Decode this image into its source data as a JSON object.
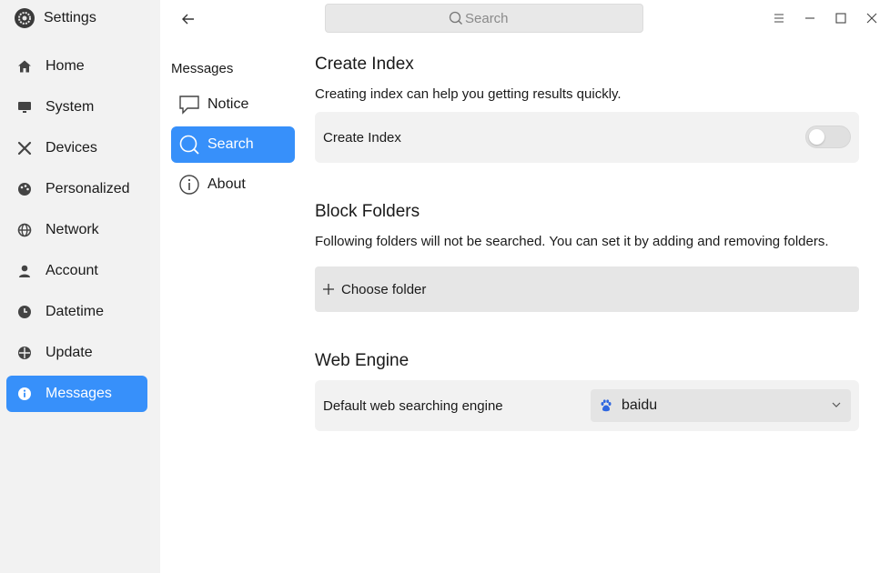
{
  "app": {
    "title": "Settings",
    "icon": "settings-gear-icon"
  },
  "sidebar": {
    "items": [
      {
        "label": "Home",
        "icon": "home-icon"
      },
      {
        "label": "System",
        "icon": "monitor-icon"
      },
      {
        "label": "Devices",
        "icon": "devices-tools-icon"
      },
      {
        "label": "Personalized",
        "icon": "palette-icon"
      },
      {
        "label": "Network",
        "icon": "globe-icon"
      },
      {
        "label": "Account",
        "icon": "person-icon"
      },
      {
        "label": "Datetime",
        "icon": "clock-icon"
      },
      {
        "label": "Update",
        "icon": "update-icon"
      },
      {
        "label": "Messages",
        "icon": "info-icon",
        "active": true
      }
    ]
  },
  "middle": {
    "heading": "Messages",
    "items": [
      {
        "label": "Notice",
        "icon": "chat-bubble-icon"
      },
      {
        "label": "Search",
        "icon": "search-icon",
        "active": true
      },
      {
        "label": "About",
        "icon": "info-circle-icon"
      }
    ]
  },
  "search": {
    "placeholder": "Search"
  },
  "content": {
    "create_index": {
      "title": "Create Index",
      "description": "Creating index can help you getting results quickly.",
      "toggle_label": "Create Index",
      "toggle_on": false
    },
    "block_folders": {
      "title": "Block Folders",
      "description": "Following folders will not be searched. You can set it by adding and removing folders.",
      "choose_label": "Choose folder"
    },
    "web_engine": {
      "title": "Web Engine",
      "row_label": "Default web searching engine",
      "selected": "baidu",
      "selected_icon": "baidu-paw-icon"
    }
  },
  "colors": {
    "accent": "#3790fa",
    "sidebar_bg": "#f2f2f2",
    "card_bg": "#f2f2f2"
  }
}
